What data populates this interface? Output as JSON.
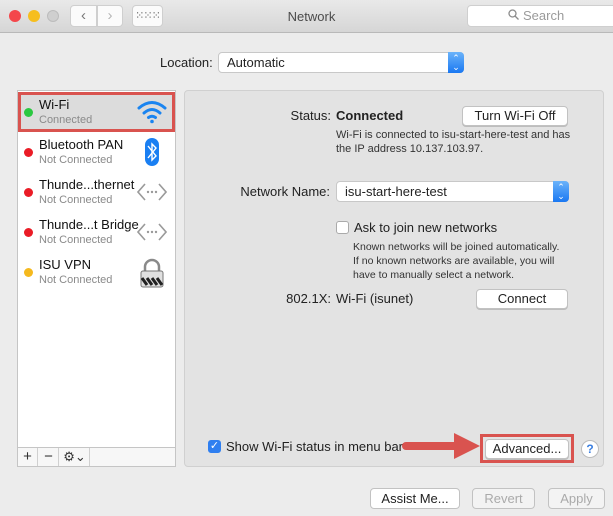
{
  "window": {
    "title": "Network",
    "search_placeholder": "Search",
    "nav_back": "‹",
    "nav_forward": "›",
    "grid_glyph": "⁙⁙⁙"
  },
  "location": {
    "label": "Location:",
    "value": "Automatic"
  },
  "services": [
    {
      "name": "Wi-Fi",
      "status": "Connected",
      "status_color": "#2ac840",
      "icon": "wifi-icon",
      "selected": true
    },
    {
      "name": "Bluetooth PAN",
      "status": "Not Connected",
      "status_color": "#ea1c26",
      "icon": "bluetooth-icon"
    },
    {
      "name": "Thunde...thernet",
      "status": "Not Connected",
      "status_color": "#ea1c26",
      "icon": "ethernet-icon"
    },
    {
      "name": "Thunde...t Bridge",
      "status": "Not Connected",
      "status_color": "#ea1c26",
      "icon": "ethernet-icon"
    },
    {
      "name": "ISU VPN",
      "status": "Not Connected",
      "status_color": "#f5b91e",
      "icon": "vpn-lock-icon"
    }
  ],
  "sidebar_actions": {
    "add": "+",
    "remove": "−",
    "gear": "⚙⌄"
  },
  "detail": {
    "status_label": "Status:",
    "status_value": "Connected",
    "toggle_button": "Turn Wi-Fi Off",
    "status_description": "Wi-Fi is connected to isu-start-here-test and has the IP address 10.137.103.97.",
    "network_name_label": "Network Name:",
    "network_name_value": "isu-start-here-test",
    "ask_join_label": "Ask to join new networks",
    "ask_join_checked": false,
    "ask_join_description": "Known networks will be joined automatically. If no known networks are available, you will have to manually select a network.",
    "dot1x_label": "802.1X:",
    "dot1x_value": "Wi-Fi (isunet)",
    "connect_button": "Connect",
    "show_status_label": "Show Wi-Fi status in menu bar",
    "show_status_checked": true,
    "advanced_button": "Advanced...",
    "help_glyph": "?"
  },
  "annotation": {
    "color": "#d9534f"
  },
  "footer": {
    "assist": "Assist Me...",
    "revert": "Revert",
    "apply": "Apply"
  }
}
